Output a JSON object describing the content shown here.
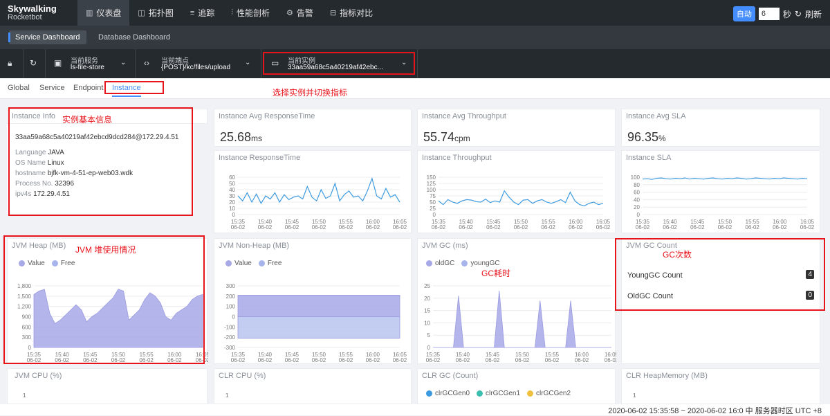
{
  "logo": {
    "line1": "Skywalking",
    "line2": "Rocketbot"
  },
  "nav": [
    {
      "icon": "▥",
      "label": "仪表盘"
    },
    {
      "icon": "◫",
      "label": "拓扑图"
    },
    {
      "icon": "≡",
      "label": "追踪"
    },
    {
      "icon": "⫶",
      "label": "性能剖析"
    },
    {
      "icon": "⚙",
      "label": "告警"
    },
    {
      "icon": "⊟",
      "label": "指标对比"
    }
  ],
  "topright": {
    "auto": "自动",
    "seconds": "6",
    "seconds_unit": "秒",
    "refresh": "刷新"
  },
  "dashboards": [
    "Service Dashboard",
    "Database Dashboard"
  ],
  "selectors": {
    "service_label": "当前服务",
    "service_value": "ls-file-store",
    "endpoint_label": "当前端点",
    "endpoint_value": "{POST}/kc/files/upload",
    "instance_label": "当前实例",
    "instance_value": "33aa59a68c5a40219af42ebc..."
  },
  "subtabs": [
    "Global",
    "Service",
    "Endpoint",
    "Instance"
  ],
  "annotations": {
    "switch": "选择实例并切换指标",
    "info": "实例基本信息",
    "heap": "JVM 堆使用情况",
    "gc_time": "GC耗时",
    "gc_count": "GC次数"
  },
  "instance_info": {
    "title": "Instance Info",
    "id": "33aa59a68c5a40219af42ebcd9dcd284@172.29.4.51",
    "language_k": "Language",
    "language_v": "JAVA",
    "os_k": "OS Name",
    "os_v": "Linux",
    "host_k": "hostname",
    "host_v": "bjfk-vm-4-51-ep-web03.wdk",
    "proc_k": "Process No.",
    "proc_v": "32396",
    "ip_k": "ipv4s",
    "ip_v": "172.29.4.51"
  },
  "cards": {
    "avg_rt": {
      "title": "Instance Avg ResponseTime",
      "value": "25.68",
      "unit": "ms"
    },
    "avg_tp": {
      "title": "Instance Avg Throughput",
      "value": "55.74",
      "unit": "cpm"
    },
    "avg_sla": {
      "title": "Instance Avg SLA",
      "value": "96.35",
      "unit": "%"
    },
    "rt": "Instance ResponseTime",
    "tp": "Instance Throughput",
    "sla": "Instance SLA",
    "heap": "JVM Heap (MB)",
    "nonheap": "JVM Non-Heap (MB)",
    "gc": "JVM GC (ms)",
    "gccount": "JVM GC Count",
    "cpu": "JVM CPU (%)",
    "clrcpu": "CLR CPU (%)",
    "clrgc": "CLR GC (Count)",
    "clrheap": "CLR HeapMemory (MB)",
    "cpu_val": "1",
    "clrcpu_val": "1",
    "clrheap_val": "1"
  },
  "gc_count": {
    "young_label": "YoungGC Count",
    "young_value": "4",
    "old_label": "OldGC Count",
    "old_value": "0"
  },
  "legends": {
    "heap": [
      "Value",
      "Free"
    ],
    "nonheap": [
      "Value",
      "Free"
    ],
    "gc": [
      "oldGC",
      "youngGC"
    ],
    "clrgc": [
      "clrGCGen0",
      "clrGCGen1",
      "clrGCGen2"
    ]
  },
  "colors": {
    "accent": "#448dfe",
    "series_purple": "#a7a8e6",
    "series_blue": "#3c9be0",
    "red": "#e8141c"
  },
  "footer": "2020-06-02 15:35:58 ~ 2020-06-02 16:0  中  服务器时区 UTC +8",
  "chart_data": [
    {
      "type": "line",
      "title": "Instance ResponseTime",
      "x": [
        "15:35\n06-02",
        "15:40\n06-02",
        "15:45\n06-02",
        "15:50\n06-02",
        "15:55\n06-02",
        "16:00\n06-02",
        "16:05\n06-02"
      ],
      "ylim": [
        0,
        60
      ],
      "yticks": [
        0,
        10,
        20,
        30,
        40,
        50,
        60
      ],
      "values": [
        30,
        22,
        35,
        20,
        33,
        18,
        30,
        25,
        35,
        20,
        32,
        24,
        28,
        30,
        25,
        45,
        28,
        22,
        40,
        26,
        30,
        50,
        22,
        32,
        38,
        28,
        30,
        22,
        38,
        58,
        30,
        25,
        42,
        28,
        32,
        20
      ]
    },
    {
      "type": "line",
      "title": "Instance Throughput",
      "x": [
        "15:35\n06-02",
        "15:40\n06-02",
        "15:45\n06-02",
        "15:50\n06-02",
        "15:55\n06-02",
        "16:00\n06-02",
        "16:05\n06-02"
      ],
      "ylim": [
        0,
        150
      ],
      "yticks": [
        0,
        25,
        50,
        75,
        100,
        125,
        150
      ],
      "values": [
        55,
        40,
        60,
        50,
        45,
        55,
        60,
        58,
        52,
        50,
        62,
        48,
        55,
        50,
        95,
        70,
        50,
        40,
        58,
        60,
        45,
        55,
        60,
        50,
        45,
        52,
        60,
        48,
        90,
        55,
        40,
        35,
        45,
        50,
        40,
        45
      ]
    },
    {
      "type": "line",
      "title": "Instance SLA",
      "x": [
        "15:35\n06-02",
        "15:40\n06-02",
        "15:45\n06-02",
        "15:50\n06-02",
        "15:55\n06-02",
        "16:00\n06-02",
        "16:05\n06-02"
      ],
      "ylim": [
        0,
        100
      ],
      "yticks": [
        0,
        20,
        40,
        60,
        80,
        100
      ],
      "values": [
        95,
        96,
        94,
        97,
        98,
        96,
        95,
        97,
        96,
        98,
        95,
        97,
        96,
        95,
        97,
        98,
        96,
        95,
        97,
        96,
        98,
        97,
        95,
        96,
        98,
        97,
        96,
        95,
        97,
        96,
        98,
        97,
        96,
        95,
        97,
        96
      ]
    },
    {
      "type": "area",
      "title": "JVM Heap (MB)",
      "x": [
        "15:35\n06-02",
        "15:40\n06-02",
        "15:45\n06-02",
        "15:50\n06-02",
        "15:55\n06-02",
        "16:00\n06-02",
        "16:05\n06-02"
      ],
      "ylim": [
        0,
        1800
      ],
      "yticks": [
        0,
        300,
        600,
        900,
        1200,
        1500,
        1800
      ],
      "series": [
        {
          "name": "Value",
          "values": [
            1550,
            1650,
            1700,
            1000,
            700,
            800,
            950,
            1100,
            1250,
            1100,
            750,
            900,
            1000,
            1150,
            1300,
            1450,
            1700,
            1650,
            800,
            950,
            1100,
            1400,
            1600,
            1500,
            1300,
            900,
            800,
            1000,
            1100,
            1200,
            1400,
            1500,
            1550
          ]
        }
      ]
    },
    {
      "type": "area",
      "title": "JVM Non-Heap (MB)",
      "x": [
        "15:35\n06-02",
        "15:40\n06-02",
        "15:45\n06-02",
        "15:50\n06-02",
        "15:55\n06-02",
        "16:00\n06-02",
        "16:05\n06-02"
      ],
      "ylim": [
        -300,
        300
      ],
      "yticks": [
        -300,
        -200,
        -100,
        0,
        100,
        200,
        300
      ],
      "series": [
        {
          "name": "Value",
          "values": [
            210,
            210,
            210,
            210,
            210,
            210,
            210
          ]
        },
        {
          "name": "Free",
          "values": [
            -210,
            -210,
            -210,
            -210,
            -210,
            -210,
            -210
          ]
        }
      ]
    },
    {
      "type": "area",
      "title": "JVM GC (ms)",
      "x": [
        "15:35\n06-02",
        "15:40\n06-02",
        "15:45\n06-02",
        "15:50\n06-02",
        "15:55\n06-02",
        "16:00\n06-02",
        "16:05\n06-02"
      ],
      "ylim": [
        0,
        25
      ],
      "yticks": [
        0,
        5,
        10,
        15,
        20,
        25
      ],
      "series": [
        {
          "name": "youngGC",
          "values": [
            0,
            0,
            0,
            0,
            0,
            21,
            0,
            0,
            0,
            0,
            0,
            0,
            0,
            23,
            0,
            0,
            0,
            0,
            0,
            0,
            0,
            19,
            0,
            0,
            0,
            0,
            0,
            19,
            0,
            0,
            0,
            0,
            0,
            0,
            0,
            0
          ]
        }
      ]
    }
  ]
}
